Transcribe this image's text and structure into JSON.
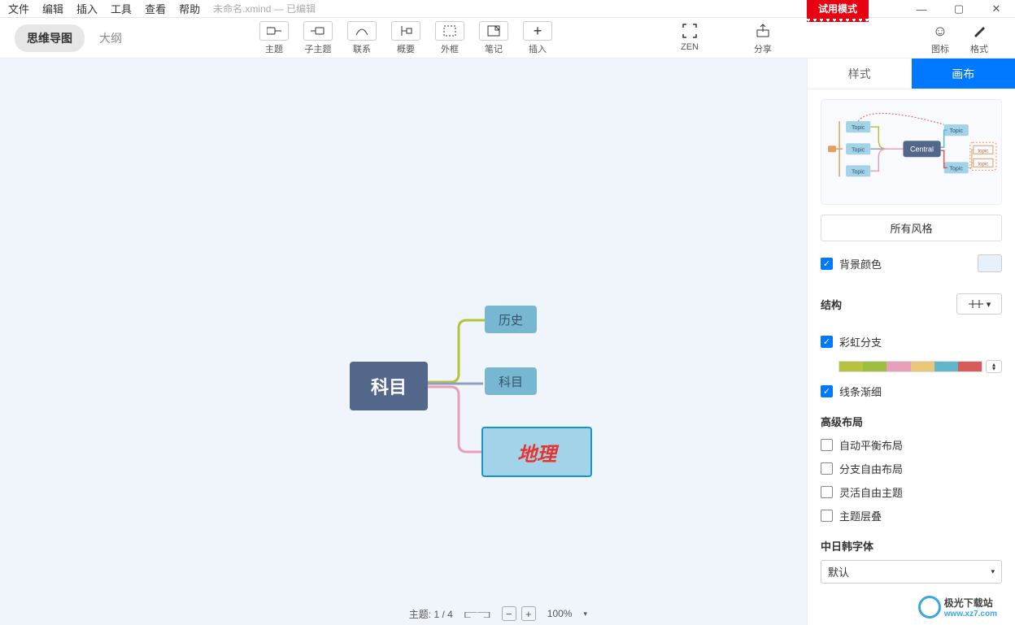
{
  "menu": [
    "文件",
    "编辑",
    "插入",
    "工具",
    "查看",
    "帮助"
  ],
  "doc": {
    "name": "未命名.xmind",
    "status": "— 已编辑"
  },
  "trial": "试用模式",
  "view": {
    "mindmap": "思维导图",
    "outline": "大纲"
  },
  "tools": [
    {
      "label": "主题"
    },
    {
      "label": "子主题"
    },
    {
      "label": "联系"
    },
    {
      "label": "概要"
    },
    {
      "label": "外框"
    },
    {
      "label": "笔记"
    },
    {
      "label": "插入"
    }
  ],
  "zen_share": [
    {
      "label": "ZEN"
    },
    {
      "label": "分享"
    }
  ],
  "rtools": [
    {
      "label": "图标"
    },
    {
      "label": "格式"
    }
  ],
  "nodes": {
    "central": "科目",
    "s1": "历史",
    "s2": "科目",
    "s3": "地理"
  },
  "panel": {
    "tab_style": "样式",
    "tab_canvas": "画布",
    "preview_central": "Central",
    "preview_topic": "Topic",
    "preview_topic_sm": "topic",
    "all_styles": "所有风格",
    "bg_color": "背景颜色",
    "structure": "结构",
    "rainbow": "彩虹分支",
    "tapered": "线条渐细",
    "adv": "高级布局",
    "auto_balance": "自动平衡布局",
    "free_branch": "分支自由布局",
    "free_topic": "灵活自由主题",
    "overlap": "主题层叠",
    "cjk": "中日韩字体",
    "font_default": "默认"
  },
  "status": {
    "topic": "主题:",
    "count": "1 / 4",
    "zoom": "100%"
  },
  "watermark": {
    "brand": "极光下载站",
    "url": "www.xz7.com"
  },
  "rainbow_colors": [
    "#b7c23e",
    "#9cbf3e",
    "#e8a0b8",
    "#e8c778",
    "#5fb7c9",
    "#d85a5a"
  ]
}
